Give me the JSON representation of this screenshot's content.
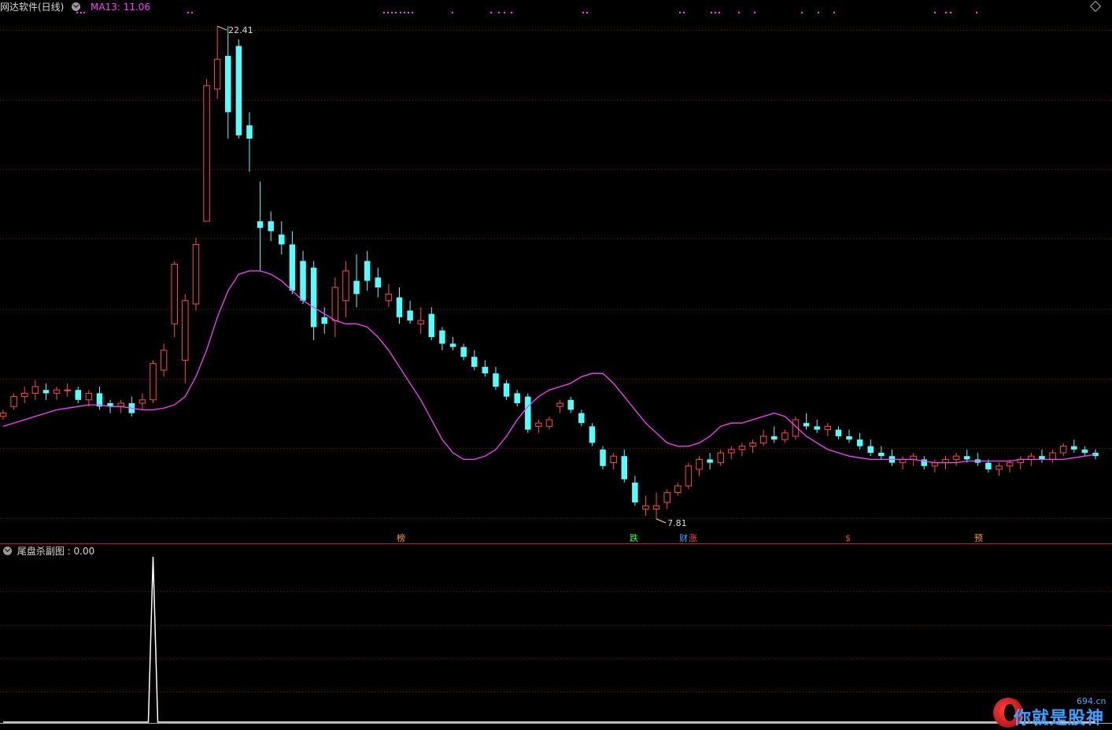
{
  "window": {
    "title": "网达软件(日线)",
    "ma_label": "MA13: 11.06",
    "indicator_title": "尾盘杀副图 : 0.00"
  },
  "colors": {
    "up": "#ff4a4a",
    "down": "#54ffff",
    "ma": "#ff40ff",
    "grid": "#7a1010",
    "divider": "#c02020",
    "indicator_line": "#ffffff"
  },
  "signals": [
    {
      "label": "榜",
      "color": "#ff9a30"
    },
    {
      "label": "跌",
      "color": "#30ff30"
    },
    {
      "label": "财",
      "color": "#5aa0ff"
    },
    {
      "label": "涨",
      "color": "#ff4040"
    },
    {
      "label": "$",
      "color": "#ff4040"
    },
    {
      "label": "预",
      "color": "#ff9a30"
    }
  ],
  "watermark": {
    "text": "你就是股神",
    "site": "694.cn"
  },
  "chart_data": [
    {
      "type": "candlestick",
      "title": "网达软件(日线)",
      "ylim": [
        7.0,
        23.0
      ],
      "grid": true,
      "high_annotation": "22.41",
      "low_annotation": "7.81",
      "series": [
        {
          "name": "MA13",
          "values": [
            10.3,
            10.4,
            10.5,
            10.6,
            10.7,
            10.8,
            10.85,
            10.9,
            10.95,
            10.95,
            10.9,
            10.9,
            10.85,
            10.8,
            10.8,
            10.85,
            10.95,
            11.2,
            11.8,
            12.6,
            13.6,
            14.4,
            14.9,
            15.0,
            15.0,
            14.9,
            14.7,
            14.4,
            14.1,
            13.9,
            13.7,
            13.5,
            13.4,
            13.4,
            13.3,
            13.0,
            12.6,
            12.1,
            11.6,
            11.1,
            10.5,
            9.9,
            9.5,
            9.3,
            9.3,
            9.4,
            9.6,
            10.0,
            10.5,
            10.9,
            11.2,
            11.4,
            11.5,
            11.6,
            11.8,
            11.9,
            11.9,
            11.6,
            11.2,
            10.8,
            10.4,
            10.1,
            9.8,
            9.7,
            9.7,
            9.8,
            10.0,
            10.3,
            10.4,
            10.4,
            10.5,
            10.6,
            10.7,
            10.6,
            10.3,
            10.0,
            9.8,
            9.6,
            9.5,
            9.4,
            9.35,
            9.3,
            9.3,
            9.3,
            9.3,
            9.3,
            9.25,
            9.2,
            9.2,
            9.2,
            9.25,
            9.25,
            9.25,
            9.25,
            9.25,
            9.3,
            9.3,
            9.3,
            9.3,
            9.3,
            9.35,
            9.4,
            9.45
          ]
        },
        {
          "name": "OHLC",
          "values": [
            [
              10.6,
              10.8,
              10.5,
              10.7
            ],
            [
              10.9,
              11.3,
              10.8,
              11.2
            ],
            [
              11.2,
              11.5,
              11.0,
              11.3
            ],
            [
              11.3,
              11.7,
              11.1,
              11.5
            ],
            [
              11.4,
              11.6,
              11.1,
              11.3
            ],
            [
              11.3,
              11.5,
              11.1,
              11.4
            ],
            [
              11.4,
              11.6,
              11.2,
              11.4
            ],
            [
              11.4,
              11.5,
              11.0,
              11.1
            ],
            [
              11.1,
              11.4,
              10.9,
              11.3
            ],
            [
              11.3,
              11.5,
              10.8,
              10.9
            ],
            [
              11.0,
              11.1,
              10.7,
              10.9
            ],
            [
              10.9,
              11.1,
              10.7,
              11.0
            ],
            [
              11.0,
              11.2,
              10.6,
              10.7
            ],
            [
              11.0,
              11.3,
              10.8,
              11.1
            ],
            [
              11.1,
              12.3,
              11.0,
              12.2
            ],
            [
              12.0,
              12.8,
              11.8,
              12.6
            ],
            [
              13.4,
              15.3,
              13.0,
              15.2
            ],
            [
              12.3,
              14.3,
              11.6,
              14.1
            ],
            [
              14.0,
              16.0,
              13.8,
              15.8
            ],
            [
              16.5,
              20.8,
              16.5,
              20.6
            ],
            [
              20.5,
              22.4,
              20.2,
              21.4
            ],
            [
              21.5,
              22.4,
              19.0,
              19.8
            ],
            [
              21.8,
              22.0,
              19.0,
              19.1
            ],
            [
              19.4,
              19.8,
              18.0,
              19.0
            ],
            [
              16.5,
              17.7,
              15.0,
              16.3
            ],
            [
              16.5,
              16.8,
              15.9,
              16.2
            ],
            [
              16.1,
              16.5,
              15.5,
              15.8
            ],
            [
              15.8,
              16.2,
              14.3,
              14.4
            ],
            [
              15.3,
              15.6,
              14.0,
              14.1
            ],
            [
              15.1,
              15.3,
              12.9,
              13.3
            ],
            [
              13.6,
              13.9,
              13.1,
              13.4
            ],
            [
              13.5,
              14.8,
              13.0,
              14.5
            ],
            [
              14.1,
              15.3,
              13.6,
              15.0
            ],
            [
              14.7,
              15.5,
              13.9,
              14.3
            ],
            [
              15.3,
              15.6,
              14.4,
              14.7
            ],
            [
              14.8,
              15.1,
              14.2,
              14.5
            ],
            [
              14.1,
              14.6,
              13.9,
              14.3
            ],
            [
              14.2,
              14.5,
              13.4,
              13.6
            ],
            [
              13.8,
              14.1,
              13.4,
              13.5
            ],
            [
              13.4,
              13.9,
              13.1,
              13.5
            ],
            [
              13.7,
              13.9,
              12.9,
              13.0
            ],
            [
              13.2,
              13.3,
              12.6,
              12.8
            ],
            [
              12.8,
              13.0,
              12.6,
              12.7
            ],
            [
              12.7,
              12.8,
              12.3,
              12.4
            ],
            [
              12.4,
              12.6,
              12.0,
              12.1
            ],
            [
              12.1,
              12.3,
              11.8,
              11.9
            ],
            [
              11.9,
              12.1,
              11.4,
              11.5
            ],
            [
              11.6,
              11.7,
              11.1,
              11.2
            ],
            [
              11.3,
              11.4,
              10.9,
              11.0
            ],
            [
              11.2,
              11.3,
              10.1,
              10.2
            ],
            [
              10.3,
              10.5,
              10.1,
              10.4
            ],
            [
              10.3,
              10.6,
              10.2,
              10.5
            ],
            [
              10.9,
              11.1,
              10.7,
              11.0
            ],
            [
              11.1,
              11.2,
              10.7,
              10.8
            ],
            [
              10.7,
              10.8,
              10.3,
              10.4
            ],
            [
              10.3,
              10.4,
              9.7,
              9.8
            ],
            [
              9.6,
              9.7,
              9.0,
              9.1
            ],
            [
              9.2,
              9.5,
              9.0,
              9.4
            ],
            [
              9.4,
              9.6,
              8.6,
              8.7
            ],
            [
              8.6,
              8.8,
              7.9,
              8.0
            ],
            [
              7.8,
              8.2,
              7.6,
              7.9
            ],
            [
              7.8,
              8.3,
              7.5,
              7.9
            ],
            [
              8.0,
              8.4,
              7.8,
              8.3
            ],
            [
              8.3,
              8.6,
              8.2,
              8.5
            ],
            [
              8.5,
              9.2,
              8.4,
              9.1
            ],
            [
              9.0,
              9.4,
              8.8,
              9.3
            ],
            [
              9.3,
              9.5,
              9.0,
              9.2
            ],
            [
              9.2,
              9.6,
              9.1,
              9.5
            ],
            [
              9.5,
              9.7,
              9.3,
              9.6
            ],
            [
              9.6,
              9.8,
              9.4,
              9.7
            ],
            [
              9.7,
              9.9,
              9.5,
              9.8
            ],
            [
              9.8,
              10.2,
              9.7,
              10.0
            ],
            [
              10.0,
              10.3,
              9.8,
              9.9
            ],
            [
              9.9,
              10.2,
              9.8,
              10.1
            ],
            [
              10.0,
              10.6,
              9.9,
              10.5
            ],
            [
              10.4,
              10.7,
              10.2,
              10.3
            ],
            [
              10.3,
              10.5,
              10.1,
              10.2
            ],
            [
              10.2,
              10.4,
              10.0,
              10.3
            ],
            [
              10.2,
              10.3,
              9.9,
              10.0
            ],
            [
              10.0,
              10.2,
              9.8,
              9.9
            ],
            [
              9.9,
              10.1,
              9.6,
              9.7
            ],
            [
              9.7,
              9.9,
              9.4,
              9.5
            ],
            [
              9.5,
              9.7,
              9.3,
              9.4
            ],
            [
              9.4,
              9.6,
              9.1,
              9.2
            ],
            [
              9.2,
              9.4,
              9.0,
              9.3
            ],
            [
              9.3,
              9.5,
              9.1,
              9.4
            ],
            [
              9.3,
              9.4,
              9.0,
              9.1
            ],
            [
              9.1,
              9.3,
              8.9,
              9.2
            ],
            [
              9.2,
              9.4,
              9.0,
              9.3
            ],
            [
              9.3,
              9.5,
              9.1,
              9.4
            ],
            [
              9.4,
              9.6,
              9.2,
              9.3
            ],
            [
              9.3,
              9.5,
              9.1,
              9.2
            ],
            [
              9.2,
              9.3,
              8.9,
              9.0
            ],
            [
              9.0,
              9.2,
              8.8,
              9.1
            ],
            [
              9.1,
              9.3,
              8.9,
              9.2
            ],
            [
              9.2,
              9.4,
              9.0,
              9.3
            ],
            [
              9.3,
              9.5,
              9.1,
              9.4
            ],
            [
              9.4,
              9.6,
              9.2,
              9.3
            ],
            [
              9.3,
              9.6,
              9.2,
              9.5
            ],
            [
              9.5,
              9.8,
              9.4,
              9.7
            ],
            [
              9.7,
              9.9,
              9.5,
              9.6
            ],
            [
              9.6,
              9.7,
              9.4,
              9.5
            ],
            [
              9.5,
              9.6,
              9.3,
              9.4
            ]
          ]
        }
      ]
    },
    {
      "type": "line",
      "title": "尾盘杀副图",
      "ylim": [
        0,
        1
      ],
      "series": [
        {
          "name": "尾盘杀",
          "values": [
            0,
            0,
            0,
            0,
            0,
            0,
            0,
            0,
            0,
            0,
            0,
            0,
            0,
            0,
            1,
            0,
            0,
            0,
            0,
            0,
            0,
            0,
            0,
            0,
            0,
            0,
            0,
            0,
            0,
            0,
            0,
            0,
            0,
            0,
            0,
            0,
            0,
            0,
            0,
            0,
            0,
            0,
            0,
            0,
            0,
            0,
            0,
            0,
            0,
            0,
            0,
            0,
            0,
            0,
            0,
            0,
            0,
            0,
            0,
            0,
            0,
            0,
            0,
            0,
            0,
            0,
            0,
            0,
            0,
            0,
            0,
            0,
            0,
            0,
            0,
            0,
            0,
            0,
            0,
            0,
            0,
            0,
            0,
            0,
            0,
            0,
            0,
            0,
            0,
            0,
            0,
            0,
            0,
            0,
            0,
            0,
            0,
            0,
            0,
            0,
            0,
            0,
            0
          ]
        }
      ]
    }
  ]
}
